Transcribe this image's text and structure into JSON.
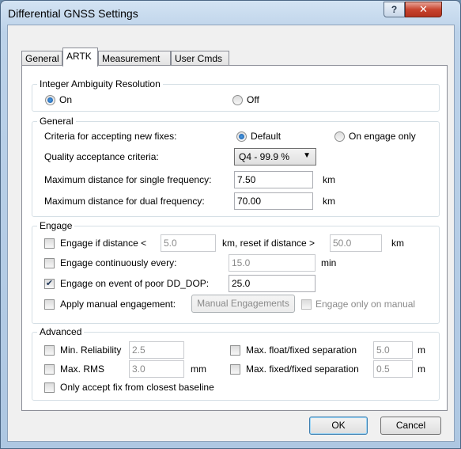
{
  "window": {
    "title": "Differential GNSS Settings",
    "help_glyph": "?",
    "close_glyph": "✕"
  },
  "tabs": [
    {
      "label": "General",
      "active": false
    },
    {
      "label": "ARTK",
      "active": true
    },
    {
      "label": "Measurement",
      "active": false
    },
    {
      "label": "User Cmds",
      "active": false
    }
  ],
  "integer_ambiguity": {
    "legend": "Integer Ambiguity Resolution",
    "on_label": "On",
    "off_label": "Off",
    "selected": "on"
  },
  "general": {
    "legend": "General",
    "criteria_label": "Criteria for accepting new fixes:",
    "criteria_default_label": "Default",
    "criteria_engage_only_label": "On engage only",
    "criteria_selected": "default",
    "quality_label": "Quality acceptance criteria:",
    "quality_value": "Q4 - 99.9 %",
    "max_single_label": "Maximum distance for single frequency:",
    "max_single_value": "7.50",
    "max_single_unit": "km",
    "max_dual_label": "Maximum distance for dual frequency:",
    "max_dual_value": "70.00",
    "max_dual_unit": "km"
  },
  "engage": {
    "legend": "Engage",
    "if_distance_label": "Engage if distance <",
    "if_distance_checked": false,
    "if_distance_value": "5.0",
    "reset_label": "km, reset if distance >",
    "reset_value": "50.0",
    "reset_unit": "km",
    "continuous_label": "Engage continuously every:",
    "continuous_checked": false,
    "continuous_value": "15.0",
    "continuous_unit": "min",
    "poor_dop_label": "Engage on event of poor DD_DOP:",
    "poor_dop_checked": true,
    "poor_dop_value": "25.0",
    "manual_label": "Apply manual engagement:",
    "manual_checked": false,
    "manual_button": "Manual Engagements",
    "manual_only_label": "Engage only on manual",
    "manual_only_checked": false
  },
  "advanced": {
    "legend": "Advanced",
    "min_reliability_label": "Min. Reliability",
    "min_reliability_checked": false,
    "min_reliability_value": "2.5",
    "max_rms_label": "Max. RMS",
    "max_rms_checked": false,
    "max_rms_value": "3.0",
    "max_rms_unit": "mm",
    "max_float_fixed_label": "Max. float/fixed separation",
    "max_float_fixed_checked": false,
    "max_float_fixed_value": "5.0",
    "max_float_fixed_unit": "m",
    "max_fixed_fixed_label": "Max. fixed/fixed separation",
    "max_fixed_fixed_checked": false,
    "max_fixed_fixed_value": "0.5",
    "max_fixed_fixed_unit": "m",
    "closest_baseline_label": "Only accept fix from closest baseline",
    "closest_baseline_checked": false
  },
  "footer": {
    "ok_label": "OK",
    "cancel_label": "Cancel"
  },
  "glyphs": {
    "check": "✔",
    "dropdown_arrow": "▼"
  }
}
